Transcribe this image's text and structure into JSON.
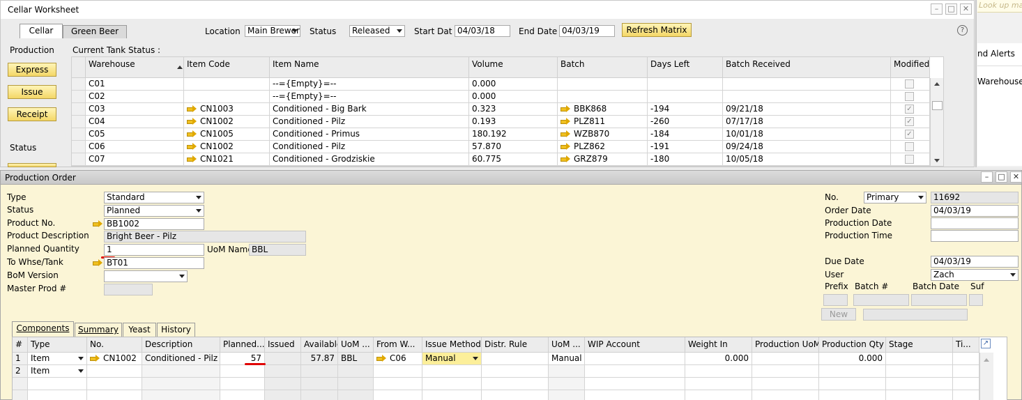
{
  "cellar": {
    "title": "Cellar Worksheet",
    "tabs": [
      "Cellar",
      "Green Beer"
    ],
    "location_label": "Location",
    "location_value": "Main Brewer",
    "status_label": "Status",
    "status_value": "Released",
    "start_label": "Start Dat",
    "start_value": "04/03/18",
    "end_label": "End Date",
    "end_value": "04/03/19",
    "refresh_label": "Refresh Matrix",
    "production_label": "Production",
    "buttons": [
      "Express",
      "Issue",
      "Receipt"
    ],
    "status_section_label": "Status",
    "tank_status_label": "Current Tank Status :",
    "columns": [
      "Warehouse",
      "Item Code",
      "Item Name",
      "Volume",
      "Batch",
      "Days Left",
      "Batch Received",
      "Modified"
    ],
    "rows": [
      {
        "wh": "C01",
        "code": "",
        "name": "--={Empty}=--",
        "vol": "0.000",
        "batch": "",
        "days": "",
        "recv": "",
        "mod": false
      },
      {
        "wh": "C02",
        "code": "",
        "name": "--={Empty}=--",
        "vol": "0.000",
        "batch": "",
        "days": "",
        "recv": "",
        "mod": false
      },
      {
        "wh": "C03",
        "code": "CN1003",
        "name": "Conditioned - Big Bark",
        "vol": "0.323",
        "batch": "BBK868",
        "days": "-194",
        "recv": "09/21/18",
        "mod": true
      },
      {
        "wh": "C04",
        "code": "CN1002",
        "name": "Conditioned - Pilz",
        "vol": "0.193",
        "batch": "PLZ811",
        "days": "-260",
        "recv": "07/17/18",
        "mod": true
      },
      {
        "wh": "C05",
        "code": "CN1005",
        "name": "Conditioned - Primus",
        "vol": "180.192",
        "batch": "WZB870",
        "days": "-184",
        "recv": "10/01/18",
        "mod": true
      },
      {
        "wh": "C06",
        "code": "CN1002",
        "name": "Conditioned - Pilz",
        "vol": "57.870",
        "batch": "PLZ862",
        "days": "-191",
        "recv": "09/24/18",
        "mod": false
      },
      {
        "wh": "C07",
        "code": "CN1021",
        "name": "Conditioned - Grodziskie",
        "vol": "60.775",
        "batch": "GRZ879",
        "days": "-180",
        "recv": "10/05/18",
        "mod": false
      }
    ]
  },
  "side": {
    "lookup_placeholder": "Look up maste",
    "alerts": "nd Alerts",
    "warehouse": "Warehouse"
  },
  "order": {
    "title": "Production Order",
    "type_label": "Type",
    "type_value": "Standard",
    "status_label": "Status",
    "status_value": "Planned",
    "product_no_label": "Product No.",
    "product_no_value": "BB1002",
    "product_desc_label": "Product Description",
    "product_desc_value": "Bright Beer - Pilz",
    "planned_qty_label": "Planned Quantity",
    "planned_qty_value": "1",
    "uom_name_label": "UoM Name",
    "uom_name_value": "BBL",
    "to_whse_label": "To Whse/Tank",
    "to_whse_value": "BT01",
    "bom_label": "BoM Version",
    "bom_value": "",
    "master_label": "Master Prod #",
    "master_value": "",
    "no_label": "No.",
    "no_series": "Primary",
    "no_value": "11692",
    "order_date_label": "Order Date",
    "order_date_value": "04/03/19",
    "prod_date_label": "Production Date",
    "prod_date_value": "",
    "prod_time_label": "Production Time",
    "prod_time_value": "",
    "due_label": "Due Date",
    "due_value": "04/03/19",
    "user_label": "User",
    "user_value": "Zach",
    "prefix_label": "Prefix",
    "batch_label": "Batch #",
    "batch_date_label": "Batch Date",
    "suf_label": "Suf",
    "new_label": "New",
    "tabs": [
      "Components",
      "Summary",
      "Yeast",
      "History"
    ],
    "columns": [
      "#",
      "Type",
      "No.",
      "Description",
      "Planned...",
      "Issued",
      "Available",
      "UoM ...",
      "From W...",
      "Issue Method",
      "Distr. Rule",
      "UoM ...",
      "WIP Account",
      "Weight In",
      "Production UoM",
      "Production Qty",
      "Stage",
      "Ti..."
    ],
    "rows": [
      {
        "n": "1",
        "type": "Item",
        "no": "CN1002",
        "desc": "Conditioned - Pilz",
        "planned": "57",
        "issued": "",
        "avail": "57.87",
        "uom": "BBL",
        "from": "C06",
        "method": "Manual",
        "distr": "",
        "uom2": "Manual",
        "wip": "",
        "weight": "0.000",
        "puom": "",
        "pqty": "0.000",
        "stage": ""
      },
      {
        "n": "2",
        "type": "Item",
        "no": "",
        "desc": "",
        "planned": "",
        "issued": "",
        "avail": "",
        "uom": "",
        "from": "",
        "method": "",
        "distr": "",
        "uom2": "",
        "wip": "",
        "weight": "",
        "puom": "",
        "pqty": "",
        "stage": ""
      }
    ]
  },
  "colors": {
    "accent_yellow": "#fbf5d6",
    "button_yellow": "#f4d767",
    "underline_red": "#e00000"
  }
}
